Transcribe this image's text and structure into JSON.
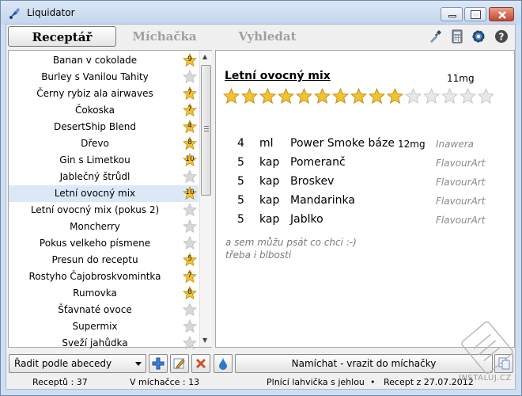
{
  "window": {
    "title": "Liquidator"
  },
  "tabs": [
    {
      "label": "Receptář"
    },
    {
      "label": "Míchačka"
    },
    {
      "label": "Vyhledat"
    }
  ],
  "toolbar_icons": [
    "dropper-icon",
    "calculator-icon",
    "gear-icon",
    "help-icon"
  ],
  "recipes": [
    {
      "name": "Banan v cokolade",
      "rating": "9"
    },
    {
      "name": "Burley s Vanilou Tahity",
      "rating": ""
    },
    {
      "name": "Černy rybiz ala airwaves",
      "rating": "7"
    },
    {
      "name": "Čokoska",
      "rating": "7"
    },
    {
      "name": "DesertShip Blend",
      "rating": "4"
    },
    {
      "name": "Dřevo",
      "rating": "8"
    },
    {
      "name": "Gin s Limetkou",
      "rating": "10"
    },
    {
      "name": "Jablečný štrůdl",
      "rating": ""
    },
    {
      "name": "Letní ovocný mix",
      "rating": "10"
    },
    {
      "name": "Letní ovocný mix (pokus 2)",
      "rating": ""
    },
    {
      "name": "Moncherry",
      "rating": ""
    },
    {
      "name": "Pokus velkeho písmene",
      "rating": ""
    },
    {
      "name": "Presun do receptu",
      "rating": "5"
    },
    {
      "name": "Rostyho Čajobroskvomintka",
      "rating": "7"
    },
    {
      "name": "Rumovka",
      "rating": "8"
    },
    {
      "name": "Šťavnaté ovoce",
      "rating": ""
    },
    {
      "name": "Supermix",
      "rating": ""
    },
    {
      "name": "Sveží jahůdka",
      "rating": ""
    }
  ],
  "selected_index": 8,
  "detail": {
    "title": "Letní ovocný mix",
    "nicotine": "11mg",
    "rating": 10,
    "max_rating": 15,
    "ingredients": [
      {
        "qty": "4",
        "unit": "ml",
        "name": "Power Smoke báze",
        "nicotine": "12mg",
        "brand": "Inawera"
      },
      {
        "qty": "5",
        "unit": "kap",
        "name": "Pomeranč",
        "nicotine": "",
        "brand": "FlavourArt"
      },
      {
        "qty": "5",
        "unit": "kap",
        "name": "Broskev",
        "nicotine": "",
        "brand": "FlavourArt"
      },
      {
        "qty": "5",
        "unit": "kap",
        "name": "Mandarinka",
        "nicotine": "",
        "brand": "FlavourArt"
      },
      {
        "qty": "5",
        "unit": "kap",
        "name": "Jablko",
        "nicotine": "",
        "brand": "FlavourArt"
      }
    ],
    "note_line1": "a sem můžu psát co chci :-)",
    "note_line2": "třeba i blbosti"
  },
  "bottom": {
    "sort_label": "Řadit podle abecedy",
    "mix_button": "Namíchat - vrazit do míchačky"
  },
  "status": {
    "recipes": "Receptů : 37",
    "in_mixer": "V míchačce : 13",
    "bottle": "Plnící lahvička s jehlou",
    "recipe_from": "Recept z 27.07.2012"
  },
  "watermark": "INSTALUJ.CZ",
  "colors": {
    "star_gold": "#f2c230",
    "star_gray": "#d8d8d8",
    "selection": "#dbe8f8"
  }
}
